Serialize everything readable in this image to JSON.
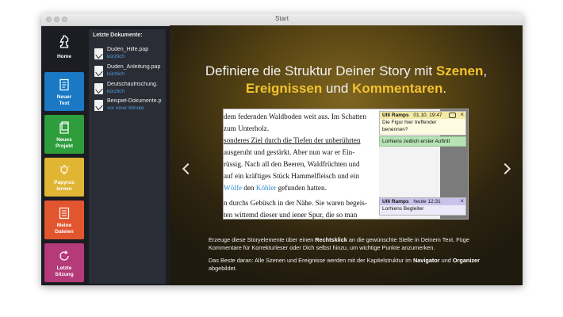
{
  "window": {
    "title": "Start"
  },
  "nav": [
    {
      "label": "Home",
      "icon": "chess-knight-icon",
      "color": "#1c1d22"
    },
    {
      "label": "Neuer Text",
      "icon": "new-document-icon",
      "color": "#1a78c4"
    },
    {
      "label": "Neues Projekt",
      "icon": "new-project-icon",
      "color": "#2e9d3c"
    },
    {
      "label": "Papyrus lernen",
      "icon": "lightbulb-icon",
      "color": "#e0b534"
    },
    {
      "label": "Meine Dateien",
      "icon": "files-icon",
      "color": "#e2562f"
    },
    {
      "label": "Letzte Sitzung",
      "icon": "refresh-icon",
      "color": "#b43a7a"
    }
  ],
  "docs": {
    "heading": "Letzte Dokumente:",
    "items": [
      {
        "name": "Duden_Hilfe.pap",
        "sub": "kürzlich"
      },
      {
        "name": "Duden_Anleitung.pap",
        "sub": "kürzlich"
      },
      {
        "name": "Deutschaufrischung.",
        "sub": "kürzlich"
      },
      {
        "name": "Beispiel-Dokumente.p",
        "sub": "vor einer Minute"
      }
    ]
  },
  "headline": {
    "l1_pre": "Definiere die Struktur Deiner Story mit ",
    "l1_hl": "Szenen",
    "l1_post": ",",
    "l2_hl1": "Ereignissen",
    "l2_mid": " und ",
    "l2_hl2": "Kommentaren",
    "l2_post": "."
  },
  "screenshot": {
    "lines": [
      "dem federnden Waldboden weit aus. Im Schatten",
      "zum Unterholz.",
      "sonderes Ziel durch die Tiefen der unberührten",
      " ausgeruht und gestärkt. Aber nun war er Ein-",
      "rüssig. Nach all den Beeren, Waldfrüchten und",
      " auf ein kräftiges Stück Hammelfleisch und ein",
      " ",
      "n durchs Gebüsch in der Nähe. Sie waren begeis-",
      "ten wittemd dieser und iener Spur, die so man"
    ],
    "line7": {
      "pre": " Wölfe",
      "mid": " den ",
      "k": "Köhler",
      "post": " gefunden hatten."
    },
    "comment1": {
      "author": "Ulli Ramps",
      "date": "01.10. 19:47",
      "text": "Die Figur hier treffender benennen?"
    },
    "event": "Lorhiens zeitlich erster Auftritt",
    "comment2": {
      "author": "Ulli Ramps",
      "date": "heute 12:31",
      "text": "Lorhiens Begleiter"
    }
  },
  "para1": {
    "a": "Erzeuge diese Storyelemente über einen ",
    "b": "Rechtsklick",
    "c": " an die gewünschte Stelle in Deinem Text. Füge Kommentare für Korrekturleser oder Dich selbst hinzu, um wichtige Punkte anzumerken."
  },
  "para2": {
    "a": "Das Beste daran: Alle Szenen und Ereignisse werden mit der Kapitelstruktur im ",
    "b": "Navigator",
    "c": " und ",
    "d": "Organizer",
    "e": " abgebildet."
  }
}
